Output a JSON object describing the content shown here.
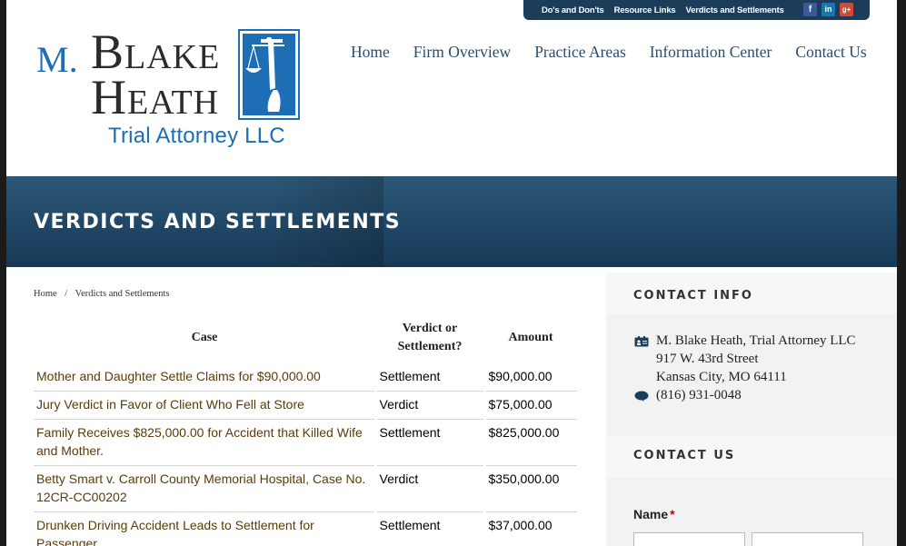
{
  "utility_links": [
    "Do's and Don'ts",
    "Resource Links",
    "Verdicts and Settlements"
  ],
  "social": {
    "facebook": "f",
    "linkedin": "in",
    "google_plus": "g+"
  },
  "logo": {
    "initial": "M.",
    "first_word": "Blake",
    "second_word": "Heath",
    "subtitle": "Trial Attorney LLC",
    "brand_color": "#1d6eb5"
  },
  "nav": [
    "Home",
    "Firm Overview",
    "Practice Areas",
    "Information Center",
    "Contact Us"
  ],
  "banner": {
    "title": "VERDICTS AND SETTLEMENTS"
  },
  "breadcrumb": {
    "home": "Home",
    "separator": "/",
    "current": "Verdicts and Settlements"
  },
  "table": {
    "headers": {
      "case": "Case",
      "type": "Verdict or Settlement?",
      "amount": "Amount"
    },
    "rows": [
      {
        "case": "Mother and Daughter Settle Claims for $90,000.00",
        "type": "Settlement",
        "amount": "$90,000.00"
      },
      {
        "case": "Jury Verdict in Favor of Client Who Fell at Store",
        "type": "Verdict",
        "amount": "$75,000.00"
      },
      {
        "case": "Family Receives $825,000.00 for Accident that Killed Wife and Mother.",
        "type": "Settlement",
        "amount": "$825,000.00"
      },
      {
        "case": "Betty Smart v. Carroll County Memorial Hospital, Case No. 12CR-CC00202",
        "type": "Verdict",
        "amount": "$350,000.00"
      },
      {
        "case": "Drunken Driving Accident Leads to Settlement for Passenger",
        "type": "Settlement",
        "amount": "$37,000.00"
      }
    ]
  },
  "sidebar": {
    "contact_info_heading": "CONTACT INFO",
    "firm_name": "M. Blake Heath, Trial Attorney LLC",
    "street": "917 W. 43rd Street",
    "city": "Kansas City, MO  64111",
    "phone": "(816) 931-0048",
    "contact_us_heading": "CONTACT US",
    "name_label": "Name",
    "required_mark": "*"
  },
  "colors": {
    "nav_text": "#2a4d6e",
    "banner": "#1f4565",
    "case_link": "#5a3c09",
    "utility_bar": "#1c3d5a"
  }
}
